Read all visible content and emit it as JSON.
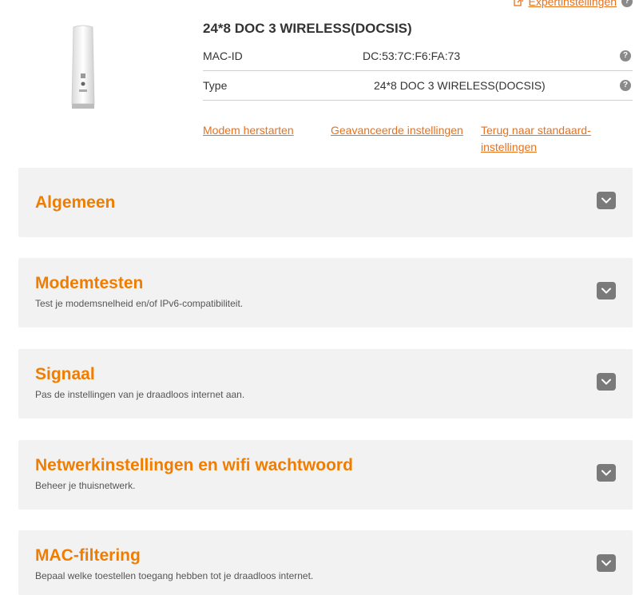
{
  "header": {
    "expert_link": "Expertinstellingen"
  },
  "modem": {
    "title": "24*8 DOC 3 WIRELESS(DOCSIS)",
    "rows": [
      {
        "label": "MAC-ID",
        "value": "DC:53:7C:F6:FA:73"
      },
      {
        "label": "Type",
        "value": "24*8 DOC 3 WIRELESS(DOCSIS)"
      }
    ],
    "help_glyph": "?"
  },
  "actions": {
    "restart": "Modem herstarten",
    "advanced": "Geavanceerde instellingen",
    "reset_line1": "Terug naar standaard-",
    "reset_line2": "instellingen"
  },
  "sections": [
    {
      "title": "Algemeen",
      "subtitle": ""
    },
    {
      "title": "Modemtesten",
      "subtitle": "Test je modemsnelheid en/of IPv6-compatibiliteit."
    },
    {
      "title": "Signaal",
      "subtitle": "Pas de instellingen van je draadloos internet aan."
    },
    {
      "title": "Netwerkinstellingen en wifi wachtwoord",
      "subtitle": "Beheer je thuisnetwerk."
    },
    {
      "title": "MAC-filtering",
      "subtitle": "Bepaal welke toestellen toegang hebben tot je draadloos internet."
    }
  ],
  "colors": {
    "accent": "#e8711c",
    "section_title": "#f07d00",
    "panel_bg": "#f2f2f2",
    "chevron_bg": "#7a7a7a"
  },
  "icons": {
    "expert": "external-link-icon",
    "help": "help-icon",
    "chevron": "chevron-down-icon"
  }
}
